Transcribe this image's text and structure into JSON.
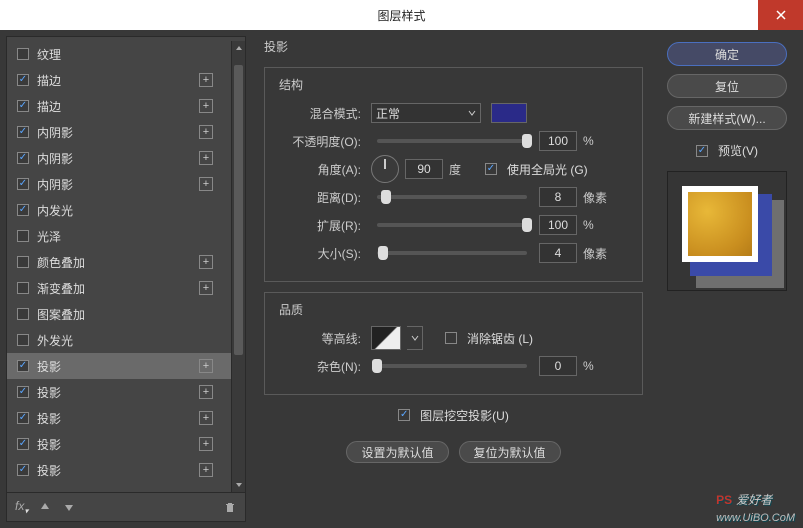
{
  "title": "图层样式",
  "closeIcon": "x",
  "effects": [
    {
      "label": "纹理",
      "checked": false,
      "has_plus": false
    },
    {
      "label": "描边",
      "checked": true,
      "has_plus": true
    },
    {
      "label": "描边",
      "checked": true,
      "has_plus": true
    },
    {
      "label": "内阴影",
      "checked": true,
      "has_plus": true
    },
    {
      "label": "内阴影",
      "checked": true,
      "has_plus": true
    },
    {
      "label": "内阴影",
      "checked": true,
      "has_plus": true
    },
    {
      "label": "内发光",
      "checked": true,
      "has_plus": false
    },
    {
      "label": "光泽",
      "checked": false,
      "has_plus": false
    },
    {
      "label": "颜色叠加",
      "checked": false,
      "has_plus": true
    },
    {
      "label": "渐变叠加",
      "checked": false,
      "has_plus": true
    },
    {
      "label": "图案叠加",
      "checked": false,
      "has_plus": false
    },
    {
      "label": "外发光",
      "checked": false,
      "has_plus": false
    },
    {
      "label": "投影",
      "checked": true,
      "has_plus": true,
      "selected": true
    },
    {
      "label": "投影",
      "checked": true,
      "has_plus": true
    },
    {
      "label": "投影",
      "checked": true,
      "has_plus": true
    },
    {
      "label": "投影",
      "checked": true,
      "has_plus": true
    },
    {
      "label": "投影",
      "checked": true,
      "has_plus": true
    }
  ],
  "panel": {
    "heading": "投影",
    "structure_title": "结构",
    "blend_label": "混合模式:",
    "blend_value": "正常",
    "color": "#2a2a88",
    "opacity_label": "不透明度(O):",
    "opacity_value": "100",
    "opacity_unit": "%",
    "opacity_pos": "100%",
    "angle_label": "角度(A):",
    "angle_value": "90",
    "angle_unit": "度",
    "global_light_label": "使用全局光 (G)",
    "global_light": true,
    "distance_label": "距离(D):",
    "distance_value": "8",
    "distance_unit": "像素",
    "distance_pos": "6%",
    "spread_label": "扩展(R):",
    "spread_value": "100",
    "spread_unit": "%",
    "spread_pos": "100%",
    "size_label": "大小(S):",
    "size_value": "4",
    "size_unit": "像素",
    "size_pos": "4%",
    "quality_title": "品质",
    "contour_label": "等高线:",
    "aa_label": "消除锯齿 (L)",
    "aa": false,
    "noise_label": "杂色(N):",
    "noise_value": "0",
    "noise_unit": "%",
    "noise_pos": "0%",
    "knockout_label": "图层挖空投影(U)",
    "knockout": true,
    "set_default": "设置为默认值",
    "reset_default": "复位为默认值"
  },
  "rightbar": {
    "ok": "确定",
    "cancel": "复位",
    "new_style": "新建样式(W)...",
    "preview": "预览(V)"
  },
  "watermark": {
    "a": "PS",
    "b": "爱好者",
    "url": "www.UiBO.CoM"
  }
}
